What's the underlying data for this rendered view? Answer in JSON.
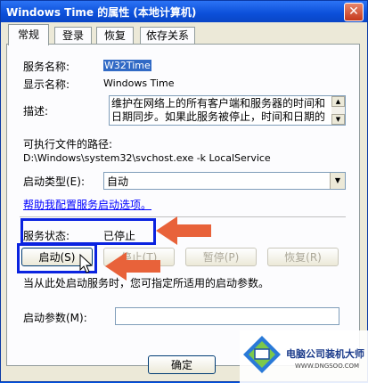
{
  "window": {
    "title": "Windows Time 的属性 (本地计算机)",
    "close_glyph": "✕"
  },
  "tabs": [
    {
      "label": "常规",
      "active": true
    },
    {
      "label": "登录",
      "active": false
    },
    {
      "label": "恢复",
      "active": false
    },
    {
      "label": "依存关系",
      "active": false
    }
  ],
  "general": {
    "service_name_label": "服务名称:",
    "service_name_value": "W32Time",
    "display_name_label": "显示名称:",
    "display_name_value": "Windows Time",
    "description_label": "描述:",
    "description_value": "维护在网络上的所有客户端和服务器的时间和日期同步。如果此服务被停止，时间和日期的",
    "exec_path_label": "可执行文件的路径:",
    "exec_path_value": "D:\\Windows\\system32\\svchost.exe -k LocalService",
    "startup_type_label": "启动类型(E):",
    "startup_type_value": "自动",
    "help_link": "帮助我配置服务启动选项。",
    "service_status_label": "服务状态:",
    "service_status_value": "已停止",
    "buttons": {
      "start": "启动(S)",
      "stop": "停止(T)",
      "pause": "暂停(P)",
      "resume": "恢复(R)"
    },
    "hint_text": "当从此处启动服务时，您可指定所适用的启动参数。",
    "start_params_label": "启动参数(M):",
    "start_params_value": ""
  },
  "footer": {
    "ok": "确定"
  },
  "watermark": {
    "name": "电脑公司装机大师",
    "url": "WWW.DNGSOO.COM"
  },
  "colors": {
    "highlight": "#0a23e0",
    "arrow": "#e8623a",
    "titlebar": "#0b4fd9",
    "link": "#0000ff"
  }
}
